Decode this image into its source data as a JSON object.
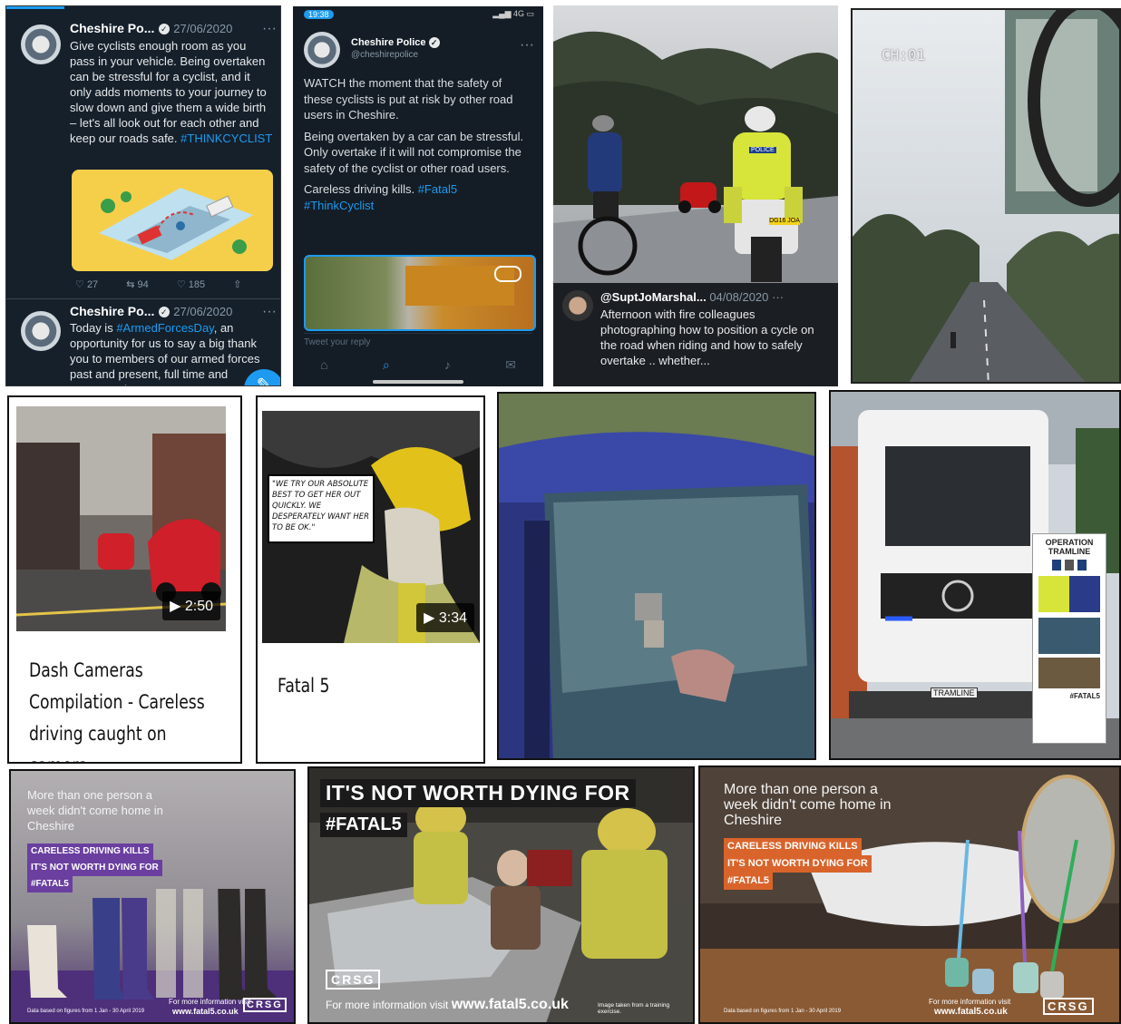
{
  "tweet1": {
    "author": "Cheshire Po...",
    "date": "27/06/2020",
    "text": "Give cyclists enough room as you pass in your vehicle. Being overtaken can be stressful for a cyclist, and it only adds moments to your journey to slow down and give them a wide birth – let's all look out for each other and keep our roads safe.",
    "hashtag": "#THINKCYCLIST",
    "replies": "27",
    "retweets": "94",
    "likes": "185"
  },
  "tweet2": {
    "author": "Cheshire Po...",
    "date": "27/06/2020",
    "text_before": "Today is ",
    "hashtag": "#ArmedForcesDay",
    "text_after": ", an opportunity for us to say a big thank you to members of our armed forces past and present, full time and reserve, who s..."
  },
  "tweet3": {
    "status_time": "19:38",
    "author": "Cheshire Police",
    "handle": "@cheshirepolice",
    "paragraph1": "WATCH the moment that the safety of these cyclists is put at risk by other road users in Cheshire.",
    "paragraph2": "Being overtaken by a car can be stressful. Only overtake if it will not compromise the safety of the cyclist or other road users.",
    "paragraph3": "Careless driving kills. ",
    "hashtag1": "#Fatal5",
    "hashtag2": "#ThinkCyclist",
    "reply_placeholder": "Tweet your reply"
  },
  "tweet4": {
    "author": "@SuptJoMarshal...",
    "date": "04/08/2020",
    "text": "Afternoon with fire colleagues photographing how to position a cycle on the road when riding and how to safely overtake .. whether...",
    "plate": "DG16 JOA",
    "police_label": "POLICE"
  },
  "dashcam": {
    "overlay": "CH:01"
  },
  "video1": {
    "duration": "2:50",
    "title": "Dash Cameras Compilation - Careless driving caught on camera"
  },
  "video2": {
    "duration": "3:34",
    "title": "Fatal 5",
    "speech": "\"WE TRY OUR ABSOLUTE BEST TO GET HER OUT QUICKLY. WE DESPERATELY WANT HER TO BE OK.\""
  },
  "tramline": {
    "banner_title": "OPERATION TRAMLINE",
    "plate": "TRAMLINE",
    "banner_hashtag": "#FATAL5"
  },
  "poster1": {
    "headline": "More than one person a week didn't come home in Cheshire",
    "line1": "CARELESS DRIVING KILLS",
    "line2": "IT'S NOT WORTH DYING FOR",
    "line3": "#FATAL5",
    "info_label": "For more information visit",
    "url": "www.fatal5.co.uk",
    "logo": "CRSG",
    "footnote": "Data based on figures from 1 Jan - 30 April 2019"
  },
  "poster2": {
    "headline": "IT'S NOT WORTH DYING FOR",
    "hashtag": "#FATAL5",
    "logo": "CRSG",
    "info_label": "For more information visit",
    "url": "www.fatal5.co.uk",
    "footnote": "Image taken from a training exercise."
  },
  "poster3": {
    "headline": "More than one person a week didn't come home in Cheshire",
    "line1": "CARELESS DRIVING KILLS",
    "line2": "IT'S NOT WORTH DYING FOR",
    "line3": "#FATAL5",
    "info_label": "For more information visit",
    "url": "www.fatal5.co.uk",
    "logo": "CRSG",
    "footnote": "Data based on figures from 1 Jan - 30 April 2019"
  },
  "colors": {
    "twitter_bg": "#15202b",
    "twitter_blue": "#1d9bf0",
    "purple_accent": "#6a3fa0",
    "orange_accent": "#d9642b",
    "hiviz_yellow": "#d7e43a"
  }
}
